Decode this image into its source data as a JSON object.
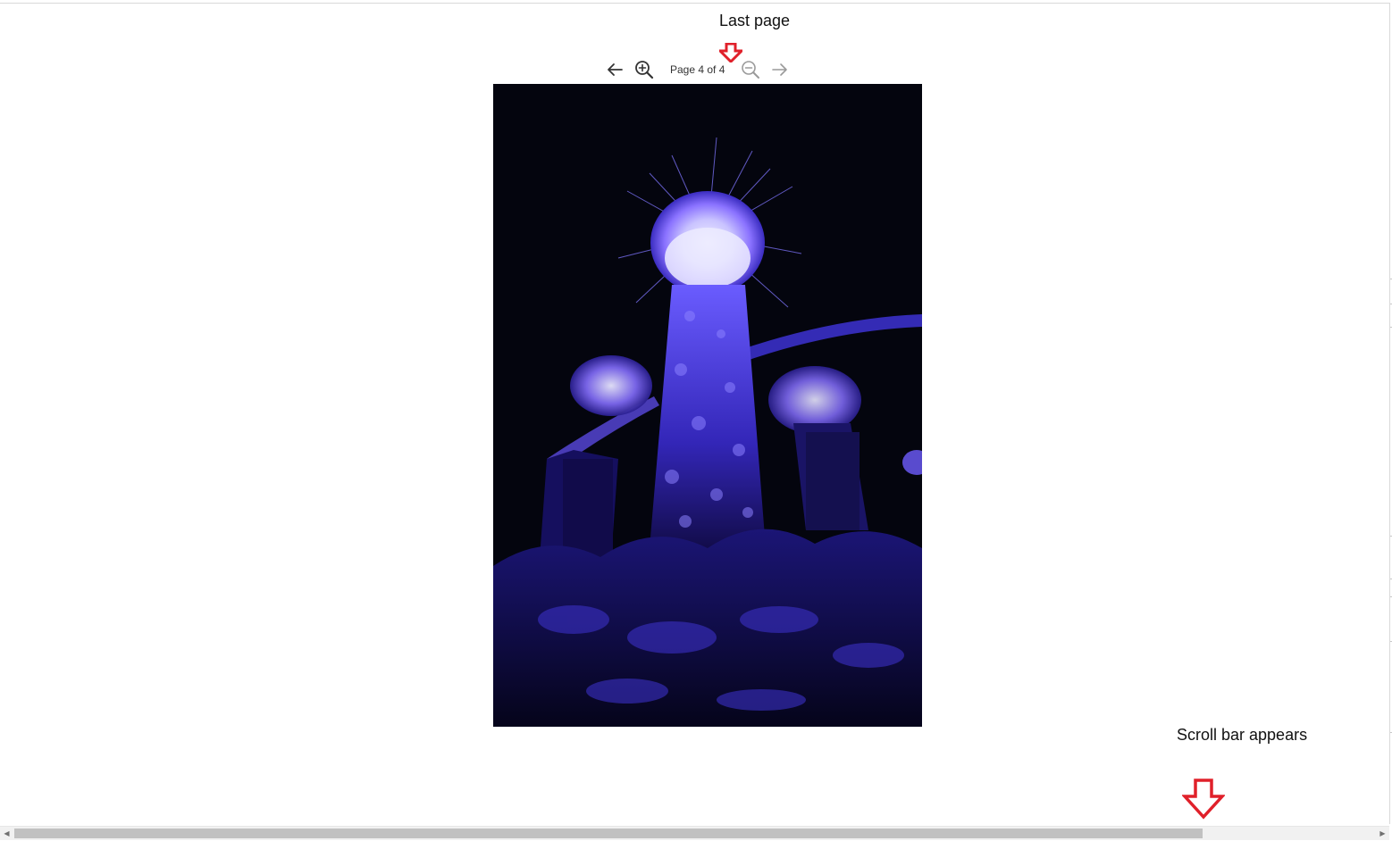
{
  "annotations": {
    "last_page": "Last page",
    "scroll_bar": "Scroll bar appears"
  },
  "viewer": {
    "page_indicator": "Page 4 of 4",
    "current_page": 4,
    "total_pages": 4,
    "prev_icon": "arrow-left-icon",
    "next_icon": "arrow-right-icon",
    "zoom_in_icon": "zoom-in-icon",
    "zoom_out_icon": "zoom-out-icon",
    "zoom_out_enabled": false,
    "next_enabled": false
  },
  "scrollbar": {
    "left_icon": "scroll-left-arrow-icon",
    "right_icon": "scroll-right-arrow-icon",
    "left_glyph": "◀",
    "right_glyph": "▶"
  },
  "colors": {
    "annotation_arrow": "#e0202a",
    "disabled_icon": "#9a9a9a",
    "enabled_icon": "#333333",
    "scroll_thumb": "#c1c1c1"
  }
}
